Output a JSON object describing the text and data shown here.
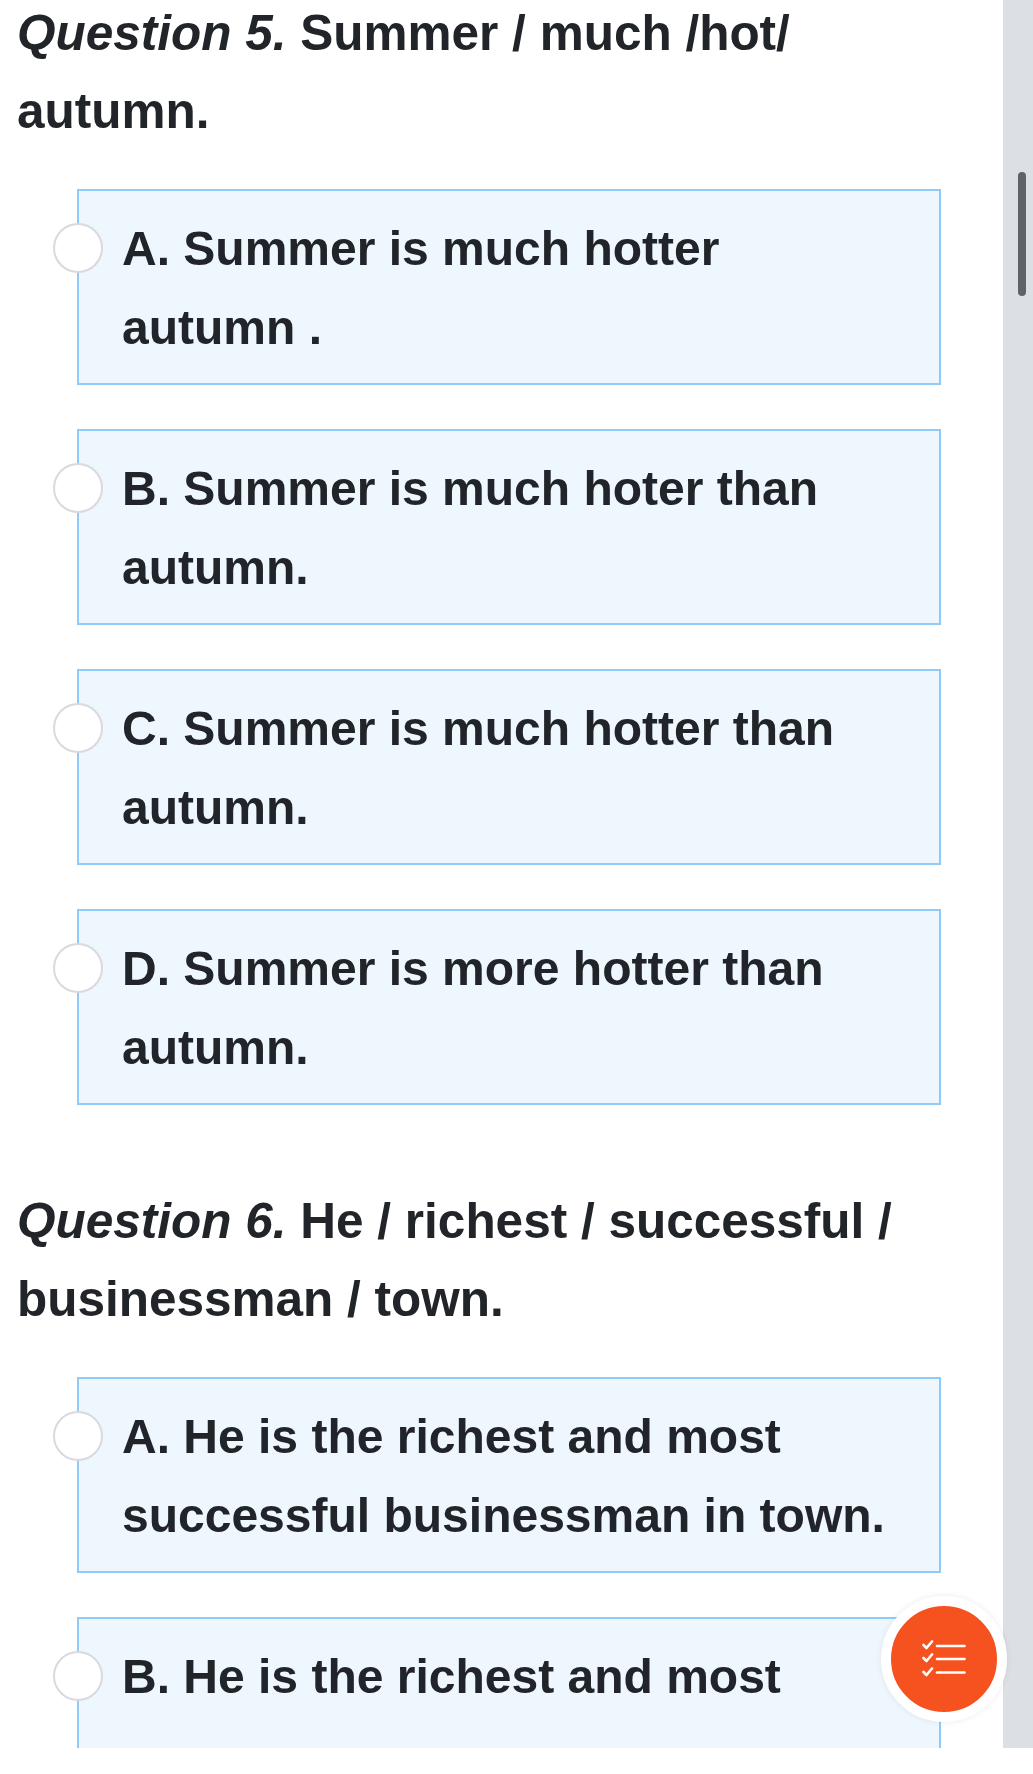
{
  "questions": [
    {
      "title": "*Question 5.* Summer / much /hot/ autumn.",
      "options": [
        {
          "text": "A. Summer is much hotter autumn .",
          "selected": false
        },
        {
          "text": "B. Summer is much hoter than autumn.",
          "selected": false
        },
        {
          "text": "C. Summer is much hotter than autumn.",
          "selected": false
        },
        {
          "text": "D. Summer is more hotter than autumn.",
          "selected": false
        }
      ]
    },
    {
      "title": "*Question 6.* He / richest / successful / businessman / town.",
      "options": [
        {
          "text": "A. He is the richest and most successful businessman in town.",
          "selected": false
        },
        {
          "text": "B. He is the richest and most",
          "selected": false
        }
      ]
    }
  ]
}
